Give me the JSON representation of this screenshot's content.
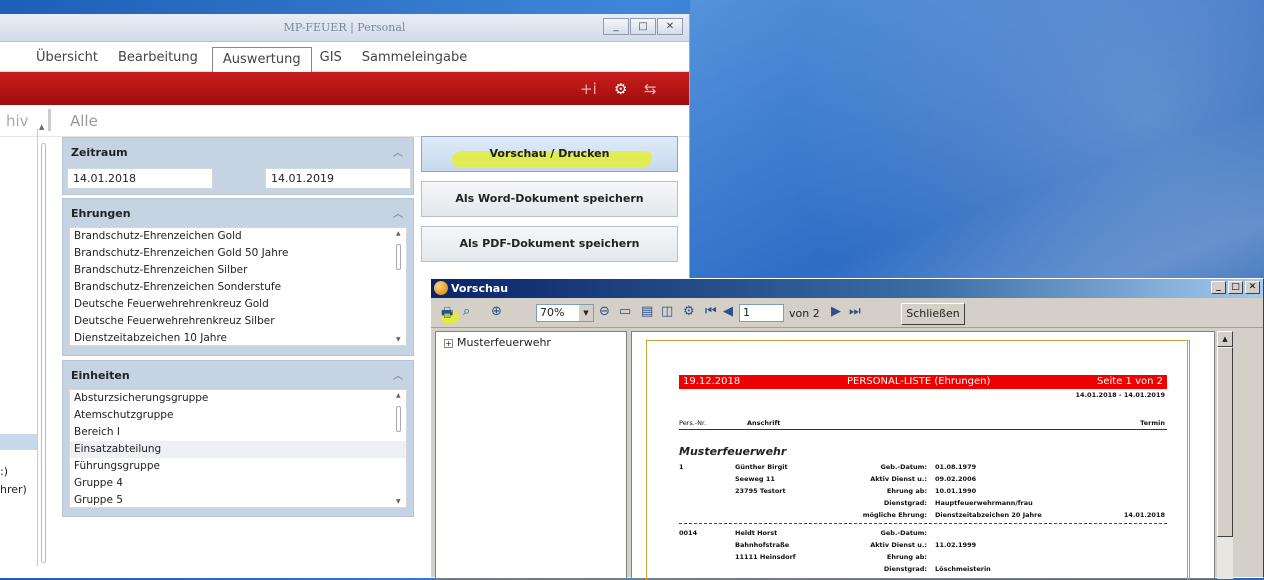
{
  "window": {
    "title": "MP-FEUER | Personal"
  },
  "menu": [
    "Übersicht",
    "Bearbeitung",
    "Auswertung",
    "GIS",
    "Sammeleingabe"
  ],
  "filter": {
    "archiv": "hiv",
    "alle": "Alle"
  },
  "leftcol": {
    "t1": ":)",
    "t2": "hrer)"
  },
  "zeitraum": {
    "title": "Zeitraum",
    "from": "14.01.2018",
    "to": "14.01.2019"
  },
  "ehrungen": {
    "title": "Ehrungen",
    "items": [
      "Brandschutz-Ehrenzeichen Gold",
      "Brandschutz-Ehrenzeichen Gold 50 Jahre",
      "Brandschutz-Ehrenzeichen Silber",
      "Brandschutz-Ehrenzeichen Sonderstufe",
      "Deutsche Feuerwehrehrenkreuz Gold",
      "Deutsche Feuerwehrehrenkreuz Silber",
      "Dienstzeitabzeichen 10 Jahre"
    ]
  },
  "einheiten": {
    "title": "Einheiten",
    "items": [
      "Absturzsicherungsgruppe",
      "Atemschutzgruppe",
      "Bereich I",
      "Einsatzabteilung",
      "Führungsgruppe",
      "Gruppe 4",
      "Gruppe 5"
    ]
  },
  "actions": {
    "preview": "Vorschau / Drucken",
    "word": "Als Word-Dokument speichern",
    "pdf": "Als PDF-Dokument speichern"
  },
  "preview_window": {
    "title": "Vorschau",
    "zoom": "70%",
    "page_input": "1",
    "page_of": "von 2",
    "close": "Schließen",
    "tree_root": "Musterfeuerwehr"
  },
  "report": {
    "date": "19.12.2018",
    "title": "PERSONAL-LISTE (Ehrungen)",
    "page": "Seite 1 von 2",
    "range": "14.01.2018 - 14.01.2019",
    "col_nr": "Pers.-Nr.",
    "col_anschrift": "Anschrift",
    "col_termin": "Termin",
    "group": "Musterfeuerwehr",
    "p1": {
      "nr": "1",
      "name": "Günther Birgit",
      "street": "Seeweg 11",
      "city": "23795 Testort",
      "geb_l": "Geb.-Datum:",
      "geb": "01.08.1979",
      "akt_l": "Aktiv Dienst u.:",
      "akt": "09.02.2006",
      "ehr_l": "Ehrung ab:",
      "ehr": "10.01.1990",
      "dg_l": "Dienstgrad:",
      "dg": "Hauptfeuerwehrmann/frau",
      "me_l": "mögliche Ehrung:",
      "me": "Dienstzeitabzeichen 20 Jahre",
      "termin": "14.01.2018"
    },
    "p2": {
      "nr": "0014",
      "name": "Heldt Horst",
      "street": "Bahnhofstraße",
      "city": "11111 Heinsdorf",
      "geb_l": "Geb.-Datum:",
      "geb": "",
      "akt_l": "Aktiv Dienst u.:",
      "akt": "11.02.1999",
      "ehr_l": "Ehrung ab:",
      "ehr": "",
      "dg_l": "Dienstgrad:",
      "dg": "Löschmeisterin"
    }
  }
}
